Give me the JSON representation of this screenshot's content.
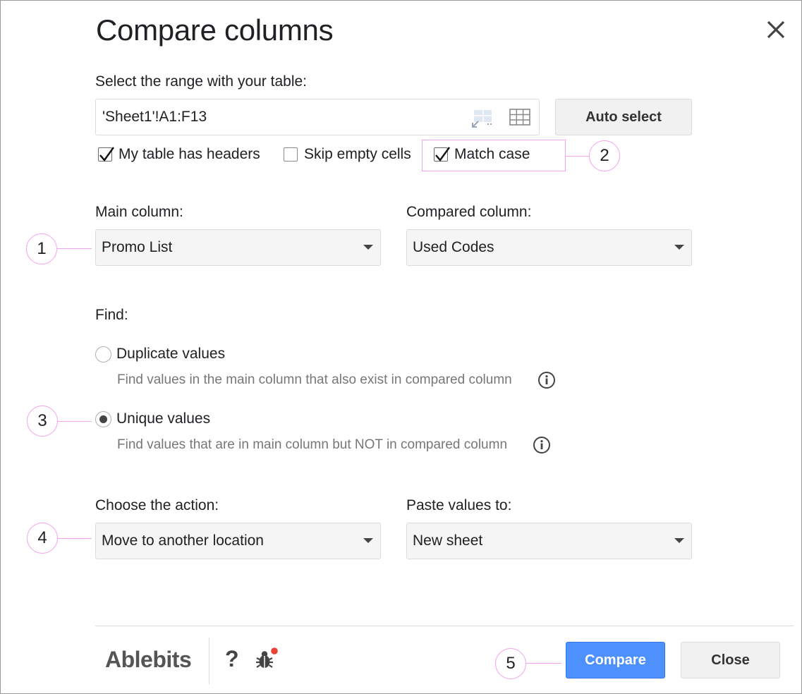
{
  "dialog": {
    "title": "Compare columns",
    "close_icon": "close-icon"
  },
  "range": {
    "label": "Select the range with your table:",
    "value": "'Sheet1'!A1:F13",
    "expand_icon": "expand-selection-icon",
    "grid_icon": "grid-icon",
    "auto_select_label": "Auto select"
  },
  "options": {
    "headers": {
      "label": "My table has headers",
      "checked": true
    },
    "skip_empty": {
      "label": "Skip empty cells",
      "checked": false
    },
    "match_case": {
      "label": "Match case",
      "checked": true
    }
  },
  "columns": {
    "main_label": "Main column:",
    "main_value": "Promo List",
    "compared_label": "Compared column:",
    "compared_value": "Used Codes"
  },
  "find": {
    "label": "Find:",
    "duplicate": {
      "label": "Duplicate values",
      "hint": "Find values in the main column that also exist in compared column",
      "selected": false
    },
    "unique": {
      "label": "Unique values",
      "hint": "Find values that are in main column but NOT in compared column",
      "selected": true
    },
    "info_icon": "info-icon"
  },
  "action": {
    "label": "Choose the action:",
    "value": "Move to another location",
    "paste_label": "Paste values to:",
    "paste_value": "New sheet"
  },
  "footer": {
    "brand": "Ablebits",
    "help": "?",
    "bug_icon": "bug-icon",
    "compare_label": "Compare",
    "close_label": "Close"
  },
  "callouts": [
    "1",
    "2",
    "3",
    "4",
    "5"
  ],
  "colors": {
    "accent": "#4d90fe",
    "callout": "#f2a3ef",
    "notification_dot": "#ea4335"
  }
}
